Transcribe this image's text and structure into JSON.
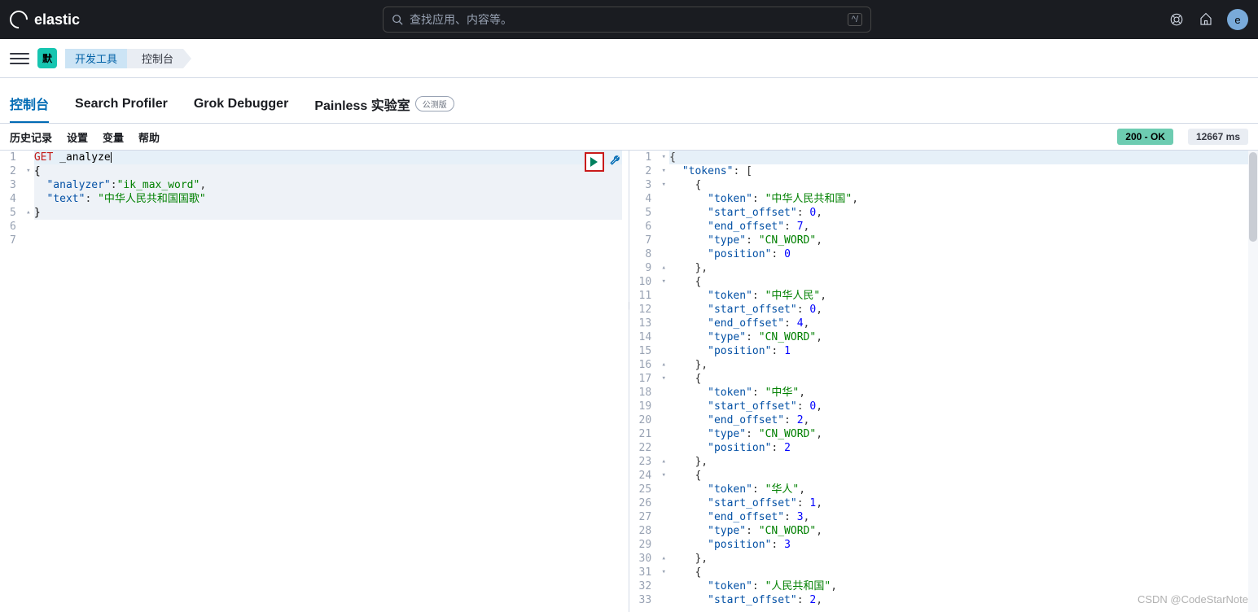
{
  "header": {
    "brand": "elastic",
    "search_placeholder": "查找应用、内容等。",
    "kbd_hint": "^/",
    "avatar_letter": "e"
  },
  "breadcrumbs": {
    "badge": "默",
    "a": "开发工具",
    "b": "控制台"
  },
  "tabs": {
    "console": "控制台",
    "profiler": "Search Profiler",
    "grok": "Grok Debugger",
    "painless": "Painless 实验室",
    "beta_label": "公测版"
  },
  "toolbar": {
    "history": "历史记录",
    "settings": "设置",
    "variables": "变量",
    "help": "帮助"
  },
  "status": {
    "code": "200 - OK",
    "time": "12667 ms"
  },
  "request": {
    "line1_method": "GET",
    "line1_path": "_analyze",
    "line2": "{",
    "line3_key": "\"analyzer\"",
    "line3_val": "\"ik_max_word\"",
    "line4_key": "\"text\"",
    "line4_val": "\"中华人民共和国国歌\"",
    "line5": "}"
  },
  "response_lines": [
    {
      "n": 1,
      "fold": "▾",
      "t": [
        [
          "p",
          "{"
        ]
      ]
    },
    {
      "n": 2,
      "fold": "▾",
      "t": [
        [
          "p",
          "  "
        ],
        [
          "k",
          "\"tokens\""
        ],
        [
          "p",
          ": ["
        ]
      ]
    },
    {
      "n": 3,
      "fold": "▾",
      "t": [
        [
          "p",
          "    {"
        ]
      ]
    },
    {
      "n": 4,
      "fold": "",
      "t": [
        [
          "p",
          "      "
        ],
        [
          "k",
          "\"token\""
        ],
        [
          "p",
          ": "
        ],
        [
          "s",
          "\"中华人民共和国\""
        ],
        [
          "p",
          ","
        ]
      ]
    },
    {
      "n": 5,
      "fold": "",
      "t": [
        [
          "p",
          "      "
        ],
        [
          "k",
          "\"start_offset\""
        ],
        [
          "p",
          ": "
        ],
        [
          "n",
          "0"
        ],
        [
          "p",
          ","
        ]
      ]
    },
    {
      "n": 6,
      "fold": "",
      "t": [
        [
          "p",
          "      "
        ],
        [
          "k",
          "\"end_offset\""
        ],
        [
          "p",
          ": "
        ],
        [
          "n",
          "7"
        ],
        [
          "p",
          ","
        ]
      ]
    },
    {
      "n": 7,
      "fold": "",
      "t": [
        [
          "p",
          "      "
        ],
        [
          "k",
          "\"type\""
        ],
        [
          "p",
          ": "
        ],
        [
          "s",
          "\"CN_WORD\""
        ],
        [
          "p",
          ","
        ]
      ]
    },
    {
      "n": 8,
      "fold": "",
      "t": [
        [
          "p",
          "      "
        ],
        [
          "k",
          "\"position\""
        ],
        [
          "p",
          ": "
        ],
        [
          "n",
          "0"
        ]
      ]
    },
    {
      "n": 9,
      "fold": "▴",
      "t": [
        [
          "p",
          "    },"
        ]
      ]
    },
    {
      "n": 10,
      "fold": "▾",
      "t": [
        [
          "p",
          "    {"
        ]
      ]
    },
    {
      "n": 11,
      "fold": "",
      "t": [
        [
          "p",
          "      "
        ],
        [
          "k",
          "\"token\""
        ],
        [
          "p",
          ": "
        ],
        [
          "s",
          "\"中华人民\""
        ],
        [
          "p",
          ","
        ]
      ]
    },
    {
      "n": 12,
      "fold": "",
      "t": [
        [
          "p",
          "      "
        ],
        [
          "k",
          "\"start_offset\""
        ],
        [
          "p",
          ": "
        ],
        [
          "n",
          "0"
        ],
        [
          "p",
          ","
        ]
      ]
    },
    {
      "n": 13,
      "fold": "",
      "t": [
        [
          "p",
          "      "
        ],
        [
          "k",
          "\"end_offset\""
        ],
        [
          "p",
          ": "
        ],
        [
          "n",
          "4"
        ],
        [
          "p",
          ","
        ]
      ]
    },
    {
      "n": 14,
      "fold": "",
      "t": [
        [
          "p",
          "      "
        ],
        [
          "k",
          "\"type\""
        ],
        [
          "p",
          ": "
        ],
        [
          "s",
          "\"CN_WORD\""
        ],
        [
          "p",
          ","
        ]
      ]
    },
    {
      "n": 15,
      "fold": "",
      "t": [
        [
          "p",
          "      "
        ],
        [
          "k",
          "\"position\""
        ],
        [
          "p",
          ": "
        ],
        [
          "n",
          "1"
        ]
      ]
    },
    {
      "n": 16,
      "fold": "▴",
      "t": [
        [
          "p",
          "    },"
        ]
      ]
    },
    {
      "n": 17,
      "fold": "▾",
      "t": [
        [
          "p",
          "    {"
        ]
      ]
    },
    {
      "n": 18,
      "fold": "",
      "t": [
        [
          "p",
          "      "
        ],
        [
          "k",
          "\"token\""
        ],
        [
          "p",
          ": "
        ],
        [
          "s",
          "\"中华\""
        ],
        [
          "p",
          ","
        ]
      ]
    },
    {
      "n": 19,
      "fold": "",
      "t": [
        [
          "p",
          "      "
        ],
        [
          "k",
          "\"start_offset\""
        ],
        [
          "p",
          ": "
        ],
        [
          "n",
          "0"
        ],
        [
          "p",
          ","
        ]
      ]
    },
    {
      "n": 20,
      "fold": "",
      "t": [
        [
          "p",
          "      "
        ],
        [
          "k",
          "\"end_offset\""
        ],
        [
          "p",
          ": "
        ],
        [
          "n",
          "2"
        ],
        [
          "p",
          ","
        ]
      ]
    },
    {
      "n": 21,
      "fold": "",
      "t": [
        [
          "p",
          "      "
        ],
        [
          "k",
          "\"type\""
        ],
        [
          "p",
          ": "
        ],
        [
          "s",
          "\"CN_WORD\""
        ],
        [
          "p",
          ","
        ]
      ]
    },
    {
      "n": 22,
      "fold": "",
      "t": [
        [
          "p",
          "      "
        ],
        [
          "k",
          "\"position\""
        ],
        [
          "p",
          ": "
        ],
        [
          "n",
          "2"
        ]
      ]
    },
    {
      "n": 23,
      "fold": "▴",
      "t": [
        [
          "p",
          "    },"
        ]
      ]
    },
    {
      "n": 24,
      "fold": "▾",
      "t": [
        [
          "p",
          "    {"
        ]
      ]
    },
    {
      "n": 25,
      "fold": "",
      "t": [
        [
          "p",
          "      "
        ],
        [
          "k",
          "\"token\""
        ],
        [
          "p",
          ": "
        ],
        [
          "s",
          "\"华人\""
        ],
        [
          "p",
          ","
        ]
      ]
    },
    {
      "n": 26,
      "fold": "",
      "t": [
        [
          "p",
          "      "
        ],
        [
          "k",
          "\"start_offset\""
        ],
        [
          "p",
          ": "
        ],
        [
          "n",
          "1"
        ],
        [
          "p",
          ","
        ]
      ]
    },
    {
      "n": 27,
      "fold": "",
      "t": [
        [
          "p",
          "      "
        ],
        [
          "k",
          "\"end_offset\""
        ],
        [
          "p",
          ": "
        ],
        [
          "n",
          "3"
        ],
        [
          "p",
          ","
        ]
      ]
    },
    {
      "n": 28,
      "fold": "",
      "t": [
        [
          "p",
          "      "
        ],
        [
          "k",
          "\"type\""
        ],
        [
          "p",
          ": "
        ],
        [
          "s",
          "\"CN_WORD\""
        ],
        [
          "p",
          ","
        ]
      ]
    },
    {
      "n": 29,
      "fold": "",
      "t": [
        [
          "p",
          "      "
        ],
        [
          "k",
          "\"position\""
        ],
        [
          "p",
          ": "
        ],
        [
          "n",
          "3"
        ]
      ]
    },
    {
      "n": 30,
      "fold": "▴",
      "t": [
        [
          "p",
          "    },"
        ]
      ]
    },
    {
      "n": 31,
      "fold": "▾",
      "t": [
        [
          "p",
          "    {"
        ]
      ]
    },
    {
      "n": 32,
      "fold": "",
      "t": [
        [
          "p",
          "      "
        ],
        [
          "k",
          "\"token\""
        ],
        [
          "p",
          ": "
        ],
        [
          "s",
          "\"人民共和国\""
        ],
        [
          "p",
          ","
        ]
      ]
    },
    {
      "n": 33,
      "fold": "",
      "t": [
        [
          "p",
          "      "
        ],
        [
          "k",
          "\"start_offset\""
        ],
        [
          "p",
          ": "
        ],
        [
          "n",
          "2"
        ],
        [
          "p",
          ","
        ]
      ]
    }
  ],
  "watermark": "CSDN @CodeStarNote"
}
